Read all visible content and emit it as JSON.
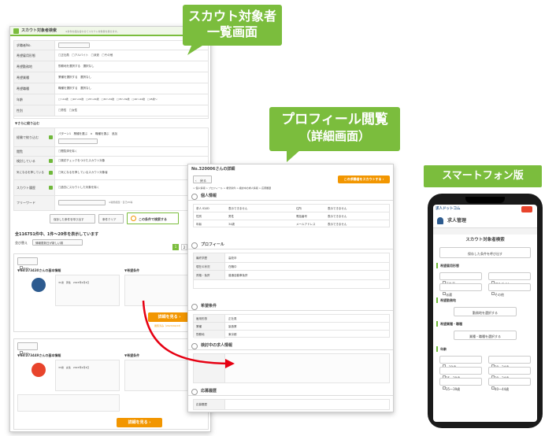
{
  "callouts": {
    "list_view": {
      "line1": "スカウト対象者",
      "line2": "一覧画面"
    },
    "profile_view": {
      "line1": "プロフィール閲覧",
      "line2": "（詳細画面）"
    },
    "smartphone": {
      "label": "スマートフォン版"
    }
  },
  "list_panel": {
    "search_title": "スカウト対象者検索",
    "search_note": "※条件を組み合わせてスカウト対象者を探せます。",
    "fields": [
      {
        "label": "求職者No.",
        "value": ""
      },
      {
        "label": "希望雇用形態",
        "value": "□正社員　□アルバイト　□派遣　□その他"
      },
      {
        "label": "希望勤務地",
        "value": "勤務地を選択する　選択なし"
      },
      {
        "label": "希望業種",
        "value": "業種を選択する　選択なし"
      },
      {
        "label": "希望職種",
        "value": "職種を選択する　選択なし"
      },
      {
        "label": "年齢",
        "value": "□〜19歳　□20〜24歳　□25〜29歳　□30〜34歳　□35〜39歳　□40〜44歳　□45歳〜"
      },
      {
        "label": "性別",
        "value": "□男性　□女性"
      }
    ],
    "refine_label": "▼さらに絞り込む",
    "refine_fields": [
      {
        "label": "経験で絞り込む",
        "value": "パターン1　業種を選ぶ　×　職種を選ぶ　追加"
      },
      {
        "label": "閲覧",
        "value": "□閲覧済を除く"
      },
      {
        "label": "検討している",
        "value": "□検討チェックをつけたスカウト対象"
      },
      {
        "label": "気になるを押している",
        "value": "□気になるを押しているスカウト対象者"
      },
      {
        "label": "スカウト履歴",
        "value": "□過去にスカウトした対象を除く"
      },
      {
        "label": "フリーワード",
        "value": "※職務経歴・自己PR等"
      }
    ],
    "save_button": "保存した条件を呼び出す",
    "clear_button": "条件クリア",
    "search_button": "この条件で検索する",
    "result_count": "全116751件中、1件〜20件を表示しています",
    "sort_label": "並び替え",
    "sort_value": "情報更新日が新しい順",
    "pages": [
      "1",
      "2",
      "3"
    ],
    "card1": {
      "check_label": "検討",
      "title": "▼No.273430さんの基本情報",
      "hope_title": "▼希望条件",
      "info": "31歳　男性　2023年4月3日",
      "detail_button": "詳細を見る",
      "viewed": "閲覧済み（2023/04/03）"
    },
    "card2": {
      "check_label": "検討",
      "title": "▼No.273449さんの基本情報",
      "hope_title": "▼希望条件",
      "info": "33歳　女性　2023年4月3日",
      "detail_button": "詳細を見る"
    }
  },
  "profile_panel": {
    "header": "No.320006さんの詳細",
    "back_button": "戻る",
    "scout_button": "この求職者をスカウトする",
    "breadcrumb": "> 個人情報 > プロフィール > 希望条件 > 検討中の求人情報 > 応募履歴",
    "sections": {
      "personal": "個人情報",
      "profile": "プロフィール",
      "hope": "希望条件",
      "considering": "検討中の求人情報",
      "history": "応募履歴"
    },
    "personal_rows": [
      {
        "k1": "求人 ID/ID",
        "v1": "表示できません",
        "k2": "住所",
        "v2": "表示できません"
      },
      {
        "k1": "性別",
        "v1": "男性",
        "k2": "電話番号",
        "v2": "表示できません"
      },
      {
        "k1": "年齢",
        "v1": "34歳",
        "k2": "メールアドレス",
        "v2": "表示できません"
      }
    ],
    "profile_rows": [
      {
        "k": "最終学歴",
        "v": "高校卒"
      },
      {
        "k": "現在の状況",
        "v": "在職中"
      },
      {
        "k": "資格・免許",
        "v": "普通自動車免許"
      }
    ],
    "hope_rows": [
      {
        "k": "雇用形態",
        "v": "正社員"
      },
      {
        "k": "業種",
        "v": "製造業"
      },
      {
        "k": "勤務地",
        "v": "東京都"
      }
    ],
    "history_label": "応募履歴"
  },
  "phone": {
    "brand": "求人ドットコム",
    "section": "求人管理",
    "title": "スカウト対象者検索",
    "saved_button": "保存した条件を呼び出す",
    "employment_head": "希望雇用形態",
    "employment_opts": [
      "正社員",
      "アルバイト",
      "派遣",
      "その他"
    ],
    "location_head": "希望勤務地",
    "location_button": "勤務地を選択する",
    "industry_head": "希望業種・職種",
    "industry_button": "業種・職種を選択する",
    "age_head": "年齢",
    "age_opts": [
      "〜19歳",
      "20〜24歳",
      "25〜29歳",
      "30〜34歳",
      "35〜39歳",
      "40〜44歳"
    ]
  },
  "colors": {
    "accent": "#7bbd3d",
    "orange": "#f29600",
    "red_arrow": "#e60012"
  }
}
